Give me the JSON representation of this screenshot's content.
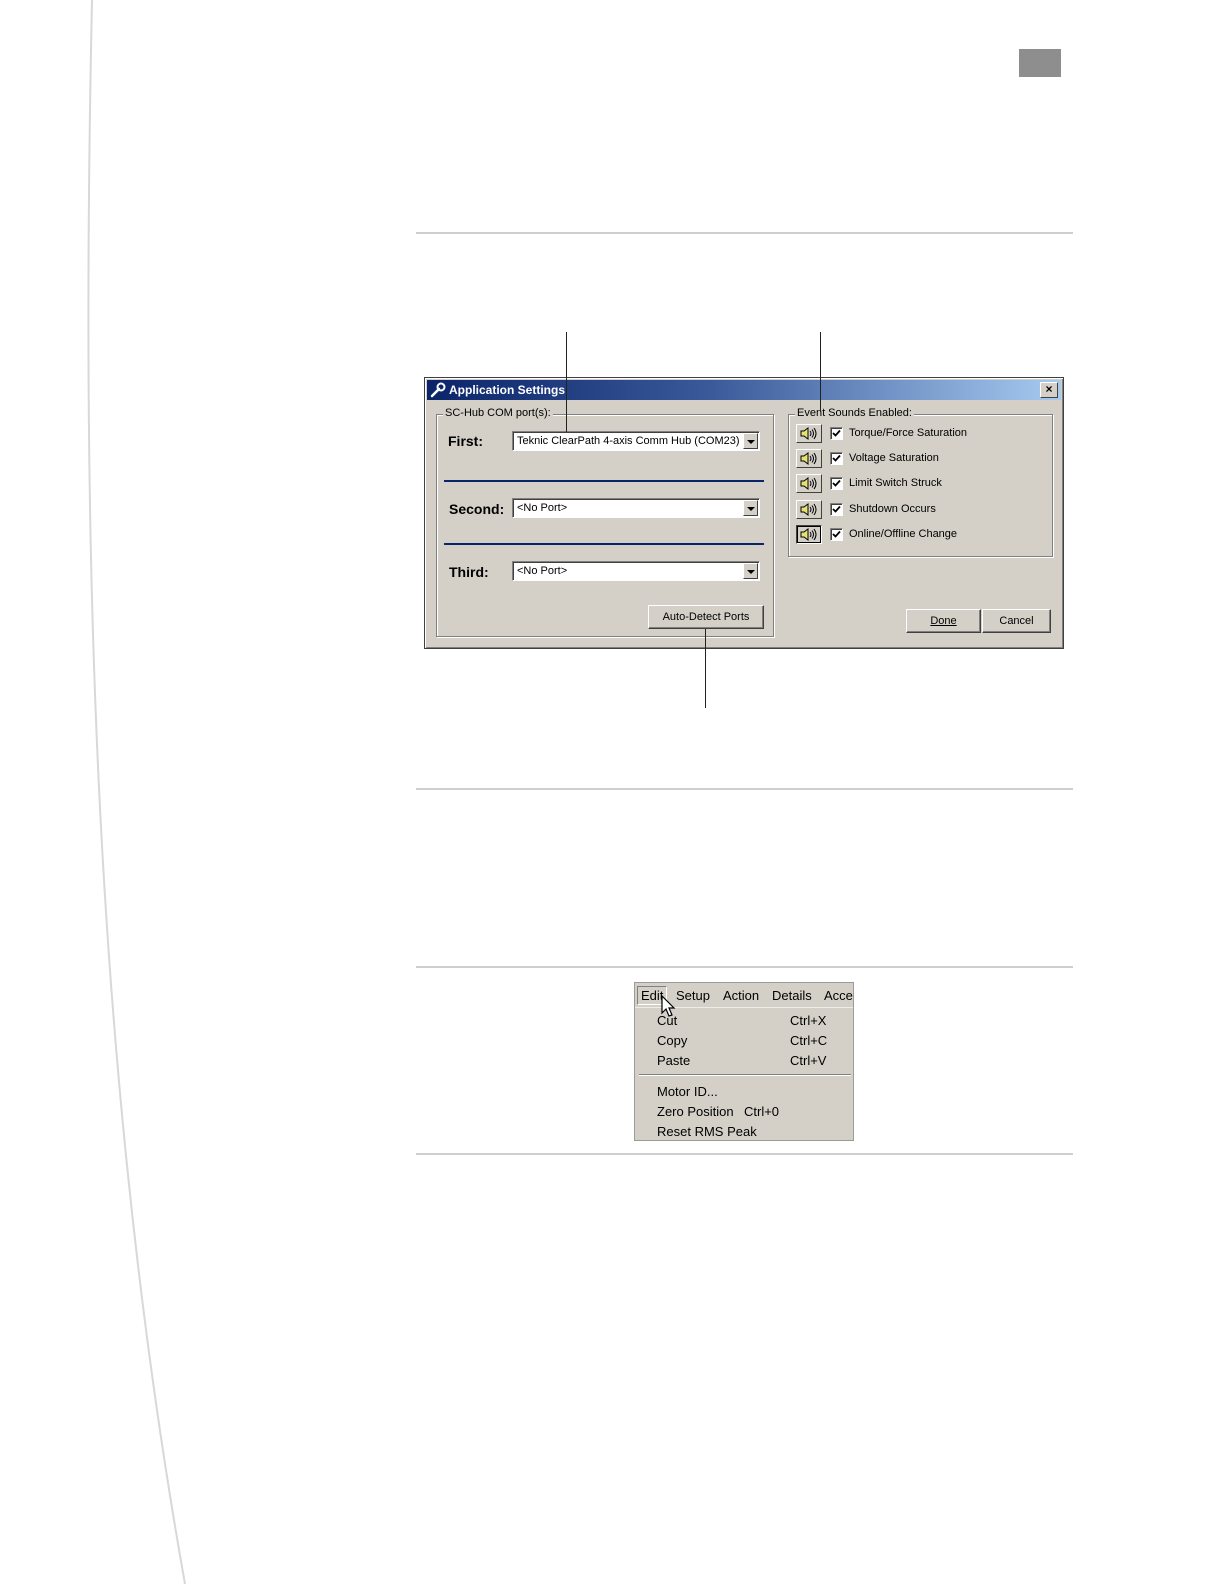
{
  "dialog": {
    "title": "Application Settings",
    "close_glyph": "×",
    "com_group": {
      "legend": "SC-Hub COM port(s):",
      "ports": [
        {
          "label": "First:",
          "value": "Teknic ClearPath 4-axis Comm Hub (COM23)"
        },
        {
          "label": "Second:",
          "value": "<No Port>"
        },
        {
          "label": "Third:",
          "value": "<No Port>"
        }
      ],
      "auto_detect_label": "Auto-Detect Ports"
    },
    "sounds_group": {
      "legend": "Event Sounds Enabled:",
      "items": [
        {
          "label": "Torque/Force Saturation",
          "checked": true
        },
        {
          "label": "Voltage Saturation",
          "checked": true
        },
        {
          "label": "Limit Switch Struck",
          "checked": true
        },
        {
          "label": "Shutdown Occurs",
          "checked": true
        },
        {
          "label": "Online/Offline Change",
          "checked": true
        }
      ]
    },
    "done_label": "Done",
    "cancel_label": "Cancel"
  },
  "edit_menu": {
    "menubar": [
      "Edit",
      "Setup",
      "Action",
      "Details",
      "Acces"
    ],
    "items": [
      {
        "label": "Cut",
        "shortcut": "Ctrl+X"
      },
      {
        "label": "Copy",
        "shortcut": "Ctrl+C"
      },
      {
        "label": "Paste",
        "shortcut": "Ctrl+V"
      },
      {
        "label": "Motor ID...",
        "shortcut": ""
      },
      {
        "label": "Zero Position",
        "shortcut": "Ctrl+0"
      },
      {
        "label": "Reset RMS Peak",
        "shortcut": ""
      }
    ]
  }
}
